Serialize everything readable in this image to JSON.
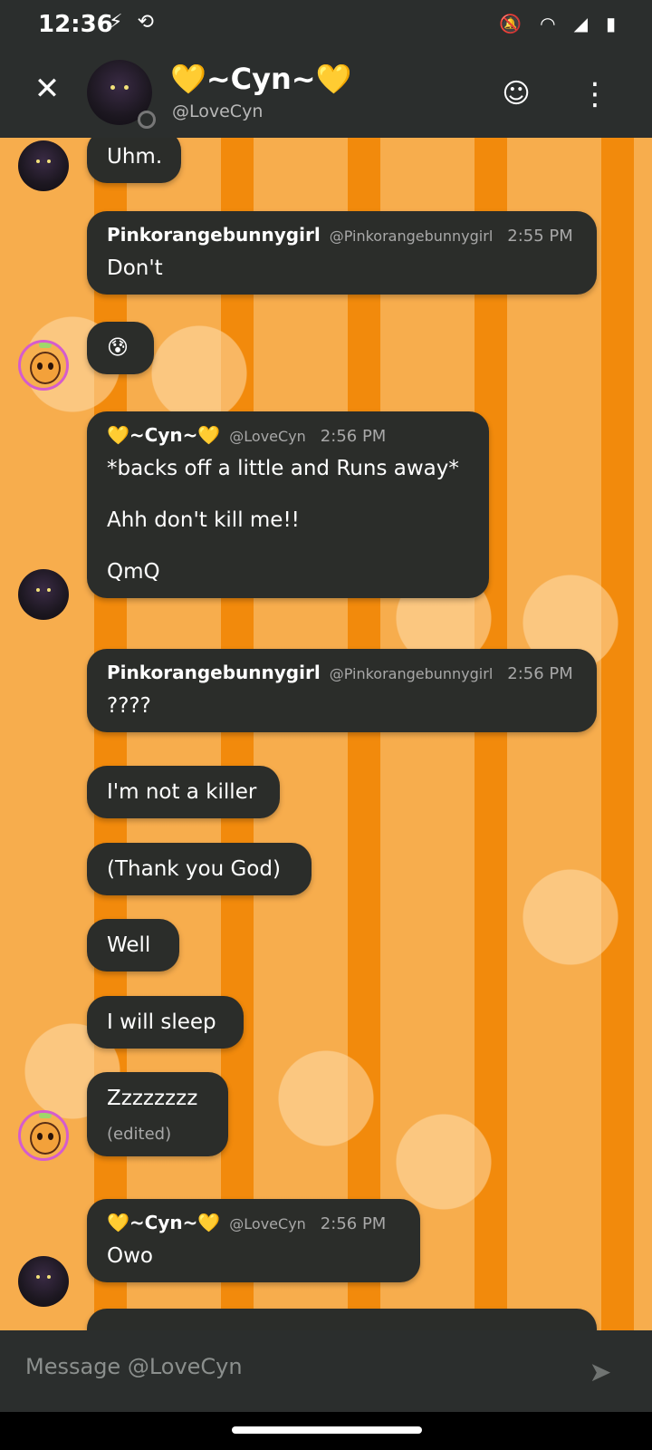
{
  "status_bar": {
    "time": "12:36",
    "left_icons": [
      "flash-icon",
      "phone-sync-icon"
    ],
    "right_icons": [
      "bell-off-icon",
      "wifi-icon",
      "signal-icon",
      "battery-icon"
    ]
  },
  "header": {
    "close_icon": "close-icon",
    "name": "💛~Cyn~💛",
    "handle": "@LoveCyn",
    "add_reaction_icon": "emoji-plus-icon",
    "more_icon": "more-vertical-icon"
  },
  "messages": [
    {
      "author_avatar": "cyn",
      "text": "Uhm."
    },
    {
      "author": "Pinkorangebunnygirl",
      "handle": "@Pinkorangebunnygirl",
      "time": "2:55 PM",
      "text": "Don't"
    },
    {
      "author_avatar": "pink",
      "text": "😰"
    },
    {
      "author": "💛~Cyn~💛",
      "handle": "@LoveCyn",
      "time": "2:56 PM",
      "lines": [
        "*backs off a little and Runs away*",
        "Ahh don't kill me!!",
        "QmQ"
      ]
    },
    {
      "author": "Pinkorangebunnygirl",
      "handle": "@Pinkorangebunnygirl",
      "time": "2:56 PM",
      "text": "????"
    },
    {
      "text": "I'm not a killer"
    },
    {
      "text": "(Thank you God)"
    },
    {
      "text": "Well"
    },
    {
      "text": "I will sleep"
    },
    {
      "text": "Zzzzzzzz",
      "edited": "(edited)"
    },
    {
      "author": "💛~Cyn~💛",
      "handle": "@LoveCyn",
      "time": "2:56 PM",
      "text": "Owo"
    }
  ],
  "composer": {
    "placeholder": "Message @LoveCyn",
    "send_icon": "send-icon"
  },
  "colors": {
    "background": "#f28a0c",
    "bubble": "#2b2d2a",
    "bar": "#2b2e2d"
  }
}
